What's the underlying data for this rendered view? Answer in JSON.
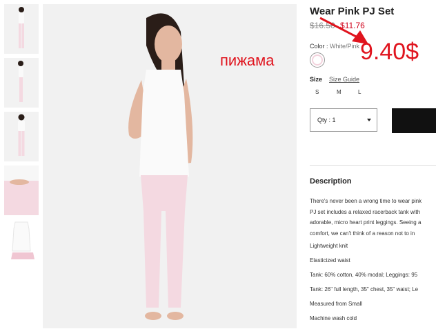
{
  "product": {
    "title": "Wear Pink PJ Set",
    "old_price": "$16.50",
    "new_price": "$11.76",
    "color_label": "Color",
    "color_value": "White/Pink",
    "size_label": "Size",
    "size_guide": "Size Guide",
    "sizes": [
      "S",
      "M",
      "L"
    ],
    "qty_label": "Qty : 1"
  },
  "description": {
    "heading": "Description",
    "paragraph": [
      "There's never been a wrong time to wear pink",
      "PJ set includes a relaxed racerback tank with",
      "adorable, micro heart print leggings. Seeing a",
      "comfort, we can't think of a reason not to in"
    ],
    "features": [
      "Lightweight knit",
      "Elasticized waist",
      "Tank: 60% cotton, 40% modal; Leggings: 95",
      "Tank: 26\" full length, 35\" chest, 35\" waist; Le",
      "Measured from Small",
      "Machine wash cold"
    ]
  },
  "annotation": {
    "word": "пижама",
    "price": "9.40$"
  },
  "colors": {
    "sale_red": "#d0021b",
    "annotation_red": "#e0141e",
    "top_white": "#f7f7f7",
    "leggings_pink": "#f4d9e1",
    "skin": "#e3b7a0",
    "hair": "#2a1d18"
  }
}
